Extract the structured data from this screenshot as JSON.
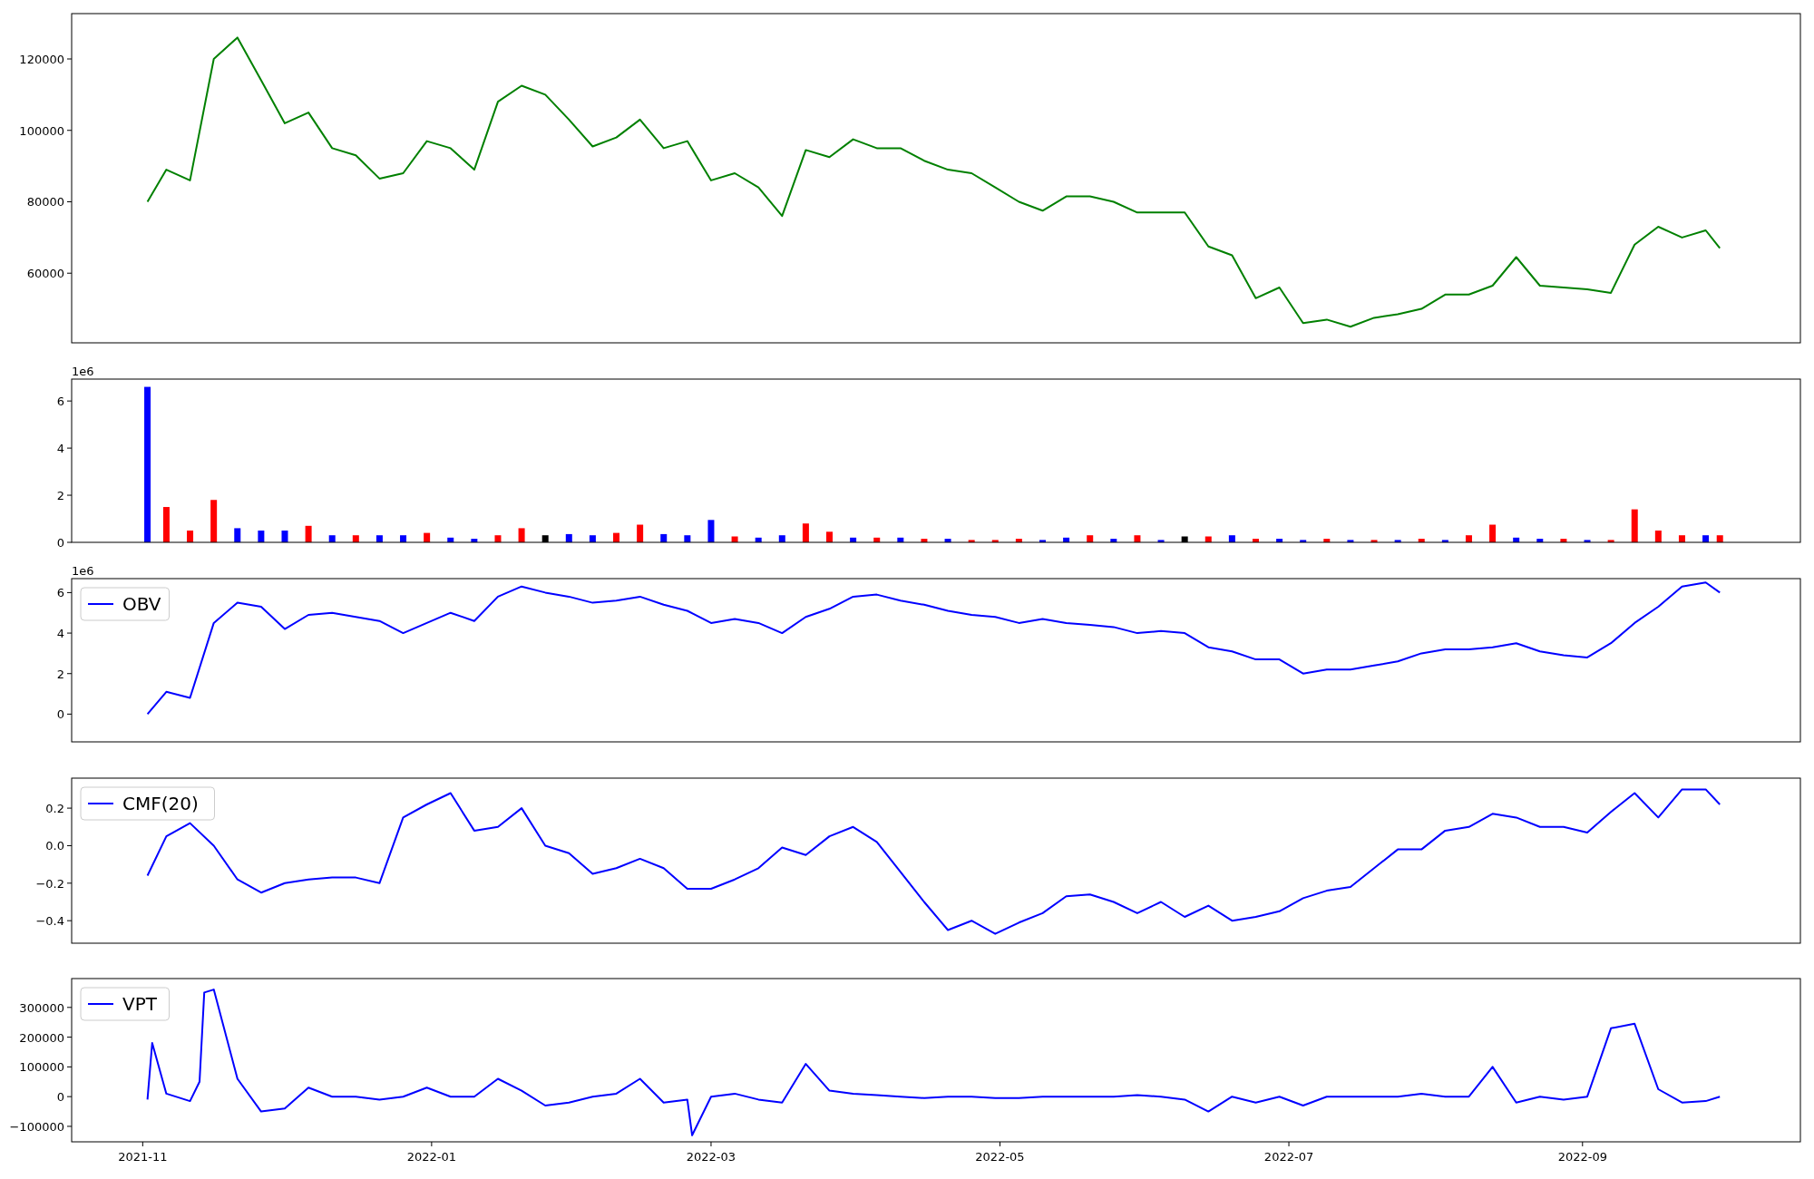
{
  "figure": {
    "panels": [
      {
        "chart_data": {
          "type": "line",
          "x": [
            "2021-11-02",
            "2021-11-06",
            "2021-11-11",
            "2021-11-16",
            "2021-11-21",
            "2021-11-26",
            "2021-12-01",
            "2021-12-06",
            "2021-12-11",
            "2021-12-16",
            "2021-12-21",
            "2021-12-26",
            "2021-12-31",
            "2022-01-05",
            "2022-01-10",
            "2022-01-15",
            "2022-01-20",
            "2022-01-25",
            "2022-01-30",
            "2022-02-04",
            "2022-02-09",
            "2022-02-14",
            "2022-02-19",
            "2022-02-24",
            "2022-03-01",
            "2022-03-06",
            "2022-03-11",
            "2022-03-16",
            "2022-03-21",
            "2022-03-26",
            "2022-03-31",
            "2022-04-05",
            "2022-04-10",
            "2022-04-15",
            "2022-04-20",
            "2022-04-25",
            "2022-04-30",
            "2022-05-05",
            "2022-05-10",
            "2022-05-15",
            "2022-05-20",
            "2022-05-25",
            "2022-05-30",
            "2022-06-04",
            "2022-06-09",
            "2022-06-14",
            "2022-06-19",
            "2022-06-24",
            "2022-06-29",
            "2022-07-04",
            "2022-07-09",
            "2022-07-14",
            "2022-07-19",
            "2022-07-24",
            "2022-07-29",
            "2022-08-03",
            "2022-08-08",
            "2022-08-13",
            "2022-08-18",
            "2022-08-23",
            "2022-08-28",
            "2022-09-02",
            "2022-09-07",
            "2022-09-12",
            "2022-09-17",
            "2022-09-22",
            "2022-09-27",
            "2022-09-30"
          ],
          "series": [
            {
              "color": "#008000",
              "values": [
                80000,
                89000,
                86000,
                120000,
                126000,
                114000,
                102000,
                105000,
                95000,
                93000,
                86500,
                88000,
                97000,
                95000,
                89000,
                108000,
                112500,
                110000,
                103000,
                95500,
                98000,
                103000,
                95000,
                97000,
                86000,
                88000,
                84000,
                76000,
                94500,
                92500,
                97500,
                95000,
                95000,
                91500,
                89000,
                88000,
                84000,
                80000,
                77500,
                81500,
                81500,
                80000,
                77000,
                77000,
                77000,
                67500,
                65000,
                53000,
                56000,
                46000,
                47000,
                45000,
                47500,
                48500,
                50000,
                54000,
                54000,
                56500,
                64500,
                56500,
                56000,
                55500,
                54500,
                68000,
                73000,
                70000,
                72000,
                67000
              ]
            }
          ],
          "xlim": [
            "2021-10-17",
            "2022-10-17"
          ],
          "ylim": [
            40500,
            132700
          ],
          "yticks": [
            60000,
            80000,
            100000,
            120000
          ]
        }
      },
      {
        "offset_label": "1e6",
        "chart_data": {
          "type": "bar",
          "x": [
            "2021-11-02",
            "2021-11-06",
            "2021-11-11",
            "2021-11-16",
            "2021-11-21",
            "2021-11-26",
            "2021-12-01",
            "2021-12-06",
            "2021-12-11",
            "2021-12-16",
            "2021-12-21",
            "2021-12-26",
            "2021-12-31",
            "2022-01-05",
            "2022-01-10",
            "2022-01-15",
            "2022-01-20",
            "2022-01-25",
            "2022-01-30",
            "2022-02-04",
            "2022-02-09",
            "2022-02-14",
            "2022-02-19",
            "2022-02-24",
            "2022-03-01",
            "2022-03-06",
            "2022-03-11",
            "2022-03-16",
            "2022-03-21",
            "2022-03-26",
            "2022-03-31",
            "2022-04-05",
            "2022-04-10",
            "2022-04-15",
            "2022-04-20",
            "2022-04-25",
            "2022-04-30",
            "2022-05-05",
            "2022-05-10",
            "2022-05-15",
            "2022-05-20",
            "2022-05-25",
            "2022-05-30",
            "2022-06-04",
            "2022-06-09",
            "2022-06-14",
            "2022-06-19",
            "2022-06-24",
            "2022-06-29",
            "2022-07-04",
            "2022-07-09",
            "2022-07-14",
            "2022-07-19",
            "2022-07-24",
            "2022-07-29",
            "2022-08-03",
            "2022-08-08",
            "2022-08-13",
            "2022-08-18",
            "2022-08-23",
            "2022-08-28",
            "2022-09-02",
            "2022-09-07",
            "2022-09-12",
            "2022-09-17",
            "2022-09-22",
            "2022-09-27",
            "2022-09-30"
          ],
          "series": [
            {
              "color": "#ff0000",
              "values": [
                null,
                1.5,
                0.5,
                1.8,
                null,
                null,
                null,
                0.7,
                null,
                0.3,
                null,
                null,
                0.4,
                null,
                null,
                0.3,
                0.6,
                null,
                null,
                null,
                0.4,
                0.75,
                null,
                null,
                null,
                0.25,
                null,
                null,
                0.8,
                0.45,
                null,
                0.2,
                null,
                0.15,
                null,
                0.1,
                0.1,
                0.15,
                null,
                null,
                0.3,
                null,
                0.3,
                null,
                null,
                0.25,
                null,
                0.15,
                null,
                null,
                0.15,
                null,
                0.1,
                null,
                0.15,
                null,
                0.3,
                0.75,
                null,
                null,
                0.15,
                null,
                0.1,
                1.4,
                0.5,
                0.3,
                null,
                0.3
              ]
            },
            {
              "color": "#0000ff",
              "values": [
                6.6,
                null,
                null,
                null,
                0.6,
                0.5,
                0.5,
                null,
                0.3,
                null,
                0.3,
                0.3,
                null,
                0.2,
                0.15,
                null,
                null,
                null,
                0.35,
                0.3,
                null,
                null,
                0.35,
                0.3,
                0.95,
                null,
                0.2,
                0.3,
                null,
                null,
                0.2,
                null,
                0.2,
                null,
                0.15,
                null,
                null,
                null,
                0.1,
                0.2,
                null,
                0.15,
                null,
                0.1,
                null,
                null,
                0.3,
                null,
                0.15,
                0.1,
                null,
                0.1,
                null,
                0.1,
                null,
                0.1,
                null,
                null,
                0.2,
                0.15,
                null,
                0.1,
                null,
                null,
                null,
                null,
                0.3,
                null
              ]
            },
            {
              "color": "#000000",
              "values": [
                null,
                null,
                null,
                null,
                null,
                null,
                null,
                null,
                null,
                null,
                null,
                null,
                null,
                null,
                null,
                null,
                null,
                0.3,
                null,
                null,
                null,
                null,
                null,
                null,
                null,
                null,
                null,
                null,
                null,
                null,
                null,
                null,
                null,
                null,
                null,
                null,
                null,
                null,
                null,
                null,
                null,
                null,
                null,
                null,
                0.25,
                null,
                null,
                null,
                null,
                null,
                null,
                null,
                null,
                null,
                null,
                null,
                null,
                null,
                null,
                null,
                null,
                null,
                null,
                null,
                null,
                null,
                null,
                null
              ]
            }
          ],
          "xlim": [
            "2021-10-17",
            "2022-10-17"
          ],
          "ylim": [
            0,
            6.93
          ],
          "yticks": [
            0,
            2,
            4,
            6
          ]
        }
      },
      {
        "offset_label": "1e6",
        "chart_data": {
          "type": "line",
          "x": [
            "2021-11-02",
            "2021-11-06",
            "2021-11-11",
            "2021-11-16",
            "2021-11-21",
            "2021-11-26",
            "2021-12-01",
            "2021-12-06",
            "2021-12-11",
            "2021-12-16",
            "2021-12-21",
            "2021-12-26",
            "2021-12-31",
            "2022-01-05",
            "2022-01-10",
            "2022-01-15",
            "2022-01-20",
            "2022-01-25",
            "2022-01-30",
            "2022-02-04",
            "2022-02-09",
            "2022-02-14",
            "2022-02-19",
            "2022-02-24",
            "2022-03-01",
            "2022-03-06",
            "2022-03-11",
            "2022-03-16",
            "2022-03-21",
            "2022-03-26",
            "2022-03-31",
            "2022-04-05",
            "2022-04-10",
            "2022-04-15",
            "2022-04-20",
            "2022-04-25",
            "2022-04-30",
            "2022-05-05",
            "2022-05-10",
            "2022-05-15",
            "2022-05-20",
            "2022-05-25",
            "2022-05-30",
            "2022-06-04",
            "2022-06-09",
            "2022-06-14",
            "2022-06-19",
            "2022-06-24",
            "2022-06-29",
            "2022-07-04",
            "2022-07-09",
            "2022-07-14",
            "2022-07-19",
            "2022-07-24",
            "2022-07-29",
            "2022-08-03",
            "2022-08-08",
            "2022-08-13",
            "2022-08-18",
            "2022-08-23",
            "2022-08-28",
            "2022-09-02",
            "2022-09-07",
            "2022-09-12",
            "2022-09-17",
            "2022-09-22",
            "2022-09-27",
            "2022-09-30"
          ],
          "series": [
            {
              "name": "OBV",
              "color": "#0000ff",
              "values": [
                0,
                1.1,
                0.8,
                4.5,
                5.5,
                5.3,
                4.2,
                4.9,
                5.0,
                4.8,
                4.6,
                4.0,
                4.5,
                5.0,
                4.6,
                5.8,
                6.3,
                6.0,
                5.8,
                5.5,
                5.6,
                5.8,
                5.4,
                5.1,
                4.5,
                4.7,
                4.5,
                4.0,
                4.8,
                5.2,
                5.8,
                5.9,
                5.6,
                5.4,
                5.1,
                4.9,
                4.8,
                4.5,
                4.7,
                4.5,
                4.4,
                4.3,
                4.0,
                4.1,
                4.0,
                3.3,
                3.1,
                2.7,
                2.7,
                2.0,
                2.2,
                2.2,
                2.4,
                2.6,
                3.0,
                3.2,
                3.2,
                3.3,
                3.5,
                3.1,
                2.9,
                2.8,
                3.5,
                4.5,
                5.3,
                6.3,
                6.5,
                6.0
              ]
            }
          ],
          "xlim": [
            "2021-10-17",
            "2022-10-17"
          ],
          "ylim": [
            -1.37,
            6.69
          ],
          "yticks": [
            0,
            2,
            4,
            6
          ]
        }
      },
      {
        "chart_data": {
          "type": "line",
          "x": [
            "2021-11-02",
            "2021-11-06",
            "2021-11-11",
            "2021-11-16",
            "2021-11-21",
            "2021-11-26",
            "2021-12-01",
            "2021-12-06",
            "2021-12-11",
            "2021-12-16",
            "2021-12-21",
            "2021-12-26",
            "2021-12-31",
            "2022-01-05",
            "2022-01-10",
            "2022-01-15",
            "2022-01-20",
            "2022-01-25",
            "2022-01-30",
            "2022-02-04",
            "2022-02-09",
            "2022-02-14",
            "2022-02-19",
            "2022-02-24",
            "2022-03-01",
            "2022-03-06",
            "2022-03-11",
            "2022-03-16",
            "2022-03-21",
            "2022-03-26",
            "2022-03-31",
            "2022-04-05",
            "2022-04-10",
            "2022-04-15",
            "2022-04-20",
            "2022-04-25",
            "2022-04-30",
            "2022-05-05",
            "2022-05-10",
            "2022-05-15",
            "2022-05-20",
            "2022-05-25",
            "2022-05-30",
            "2022-06-04",
            "2022-06-09",
            "2022-06-14",
            "2022-06-19",
            "2022-06-24",
            "2022-06-29",
            "2022-07-04",
            "2022-07-09",
            "2022-07-14",
            "2022-07-19",
            "2022-07-24",
            "2022-07-29",
            "2022-08-03",
            "2022-08-08",
            "2022-08-13",
            "2022-08-18",
            "2022-08-23",
            "2022-08-28",
            "2022-09-02",
            "2022-09-07",
            "2022-09-12",
            "2022-09-17",
            "2022-09-22",
            "2022-09-27",
            "2022-09-30"
          ],
          "series": [
            {
              "name": "CMF(20)",
              "color": "#0000ff",
              "values": [
                -0.16,
                0.05,
                0.12,
                0.0,
                -0.18,
                -0.25,
                -0.2,
                -0.18,
                -0.17,
                -0.17,
                -0.2,
                0.15,
                0.22,
                0.28,
                0.08,
                0.1,
                0.2,
                0.0,
                -0.04,
                -0.15,
                -0.12,
                -0.07,
                -0.12,
                -0.23,
                -0.23,
                -0.18,
                -0.12,
                -0.01,
                -0.05,
                0.05,
                0.1,
                0.02,
                -0.14,
                -0.3,
                -0.45,
                -0.4,
                -0.47,
                -0.41,
                -0.36,
                -0.27,
                -0.26,
                -0.3,
                -0.36,
                -0.3,
                -0.38,
                -0.32,
                -0.4,
                -0.38,
                -0.35,
                -0.28,
                -0.24,
                -0.22,
                -0.12,
                -0.02,
                -0.02,
                0.08,
                0.1,
                0.17,
                0.15,
                0.1,
                0.1,
                0.07,
                0.18,
                0.28,
                0.15,
                0.3,
                0.3,
                0.22
              ]
            }
          ],
          "xlim": [
            "2021-10-17",
            "2022-10-17"
          ],
          "ylim": [
            -0.52,
            0.36
          ],
          "yticks": [
            {
              "value": -0.4,
              "label": "−0.4"
            },
            {
              "value": -0.2,
              "label": "−0.2"
            },
            {
              "value": 0,
              "label": "0.0"
            },
            {
              "value": 0.2,
              "label": "0.2"
            }
          ]
        }
      },
      {
        "chart_data": {
          "type": "line",
          "x": [
            "2021-11-02",
            "2021-11-03",
            "2021-11-06",
            "2021-11-11",
            "2021-11-13",
            "2021-11-14",
            "2021-11-16",
            "2021-11-21",
            "2021-11-26",
            "2021-12-01",
            "2021-12-06",
            "2021-12-11",
            "2021-12-16",
            "2021-12-21",
            "2021-12-26",
            "2021-12-31",
            "2022-01-05",
            "2022-01-10",
            "2022-01-15",
            "2022-01-20",
            "2022-01-25",
            "2022-01-30",
            "2022-02-04",
            "2022-02-09",
            "2022-02-14",
            "2022-02-19",
            "2022-02-24",
            "2022-02-25",
            "2022-03-01",
            "2022-03-06",
            "2022-03-11",
            "2022-03-16",
            "2022-03-21",
            "2022-03-26",
            "2022-03-31",
            "2022-04-05",
            "2022-04-10",
            "2022-04-15",
            "2022-04-20",
            "2022-04-25",
            "2022-04-30",
            "2022-05-05",
            "2022-05-10",
            "2022-05-15",
            "2022-05-20",
            "2022-05-25",
            "2022-05-30",
            "2022-06-04",
            "2022-06-09",
            "2022-06-14",
            "2022-06-19",
            "2022-06-24",
            "2022-06-29",
            "2022-07-04",
            "2022-07-09",
            "2022-07-14",
            "2022-07-19",
            "2022-07-24",
            "2022-07-29",
            "2022-08-03",
            "2022-08-08",
            "2022-08-13",
            "2022-08-18",
            "2022-08-23",
            "2022-08-28",
            "2022-09-02",
            "2022-09-07",
            "2022-09-12",
            "2022-09-17",
            "2022-09-22",
            "2022-09-27",
            "2022-09-30"
          ],
          "series": [
            {
              "name": "VPT",
              "color": "#0000ff",
              "values": [
                -10000,
                180000,
                10000,
                -15000,
                50000,
                350000,
                360000,
                60000,
                -50000,
                -40000,
                30000,
                0,
                0,
                -10000,
                0,
                30000,
                0,
                0,
                60000,
                20000,
                -30000,
                -20000,
                0,
                10000,
                60000,
                -20000,
                -10000,
                -130000,
                0,
                10000,
                -10000,
                -20000,
                110000,
                20000,
                10000,
                5000,
                0,
                -5000,
                0,
                0,
                -5000,
                -5000,
                0,
                0,
                0,
                0,
                5000,
                0,
                -10000,
                -50000,
                0,
                -20000,
                0,
                -30000,
                0,
                0,
                0,
                0,
                10000,
                0,
                0,
                100000,
                -20000,
                0,
                -10000,
                0,
                230000,
                245000,
                25000,
                -20000,
                -15000,
                0
              ]
            }
          ],
          "xlim": [
            "2021-10-17",
            "2022-10-17"
          ],
          "ylim": [
            -152000,
            397000
          ],
          "yticks": [
            {
              "value": -100000,
              "label": "−100000"
            },
            0,
            100000,
            200000,
            300000
          ],
          "xticks": [
            {
              "value": "2021-11-01",
              "label": "2021-11"
            },
            {
              "value": "2022-01-01",
              "label": "2022-01"
            },
            {
              "value": "2022-03-01",
              "label": "2022-03"
            },
            {
              "value": "2022-05-01",
              "label": "2022-05"
            },
            {
              "value": "2022-07-01",
              "label": "2022-07"
            },
            {
              "value": "2022-09-01",
              "label": "2022-09"
            }
          ]
        }
      }
    ]
  }
}
